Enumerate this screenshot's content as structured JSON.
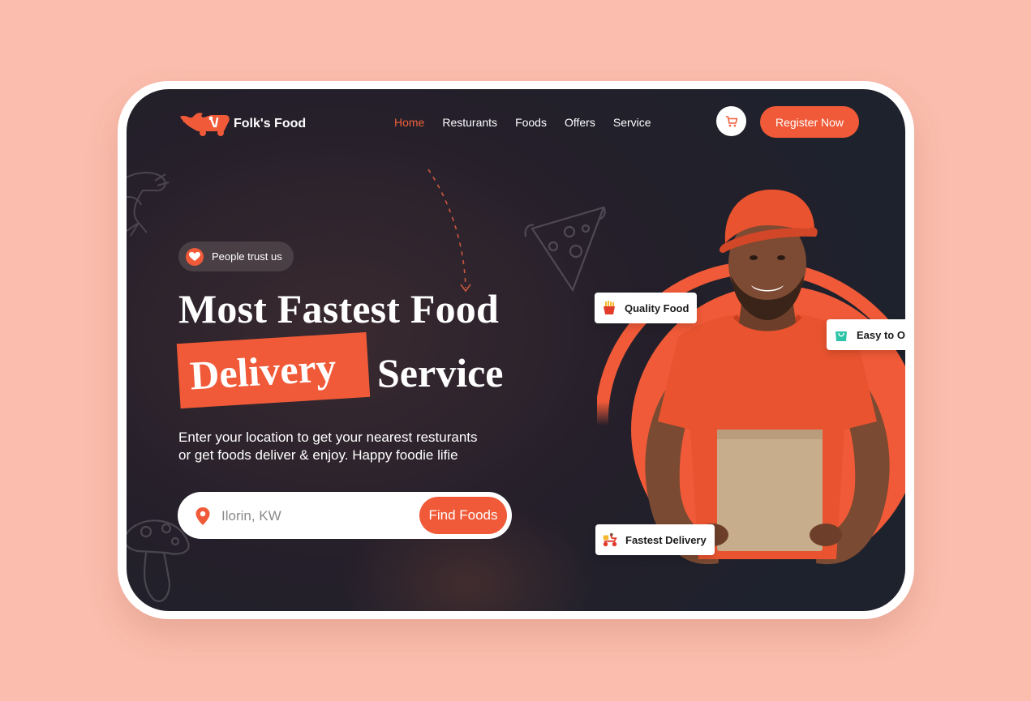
{
  "brand": {
    "name": "Folk's Food"
  },
  "nav": {
    "items": [
      {
        "label": "Home",
        "active": true
      },
      {
        "label": "Resturants",
        "active": false
      },
      {
        "label": "Foods",
        "active": false
      },
      {
        "label": "Offers",
        "active": false
      },
      {
        "label": "Service",
        "active": false
      }
    ],
    "cart_icon": "cart-icon",
    "register_label": "Register Now"
  },
  "hero": {
    "trust_label": "People trust us",
    "title_line1": "Most Fastest Food",
    "title_highlight": "Delivery",
    "title_line2_rest": "Service",
    "description_line1": "Enter your location to get your nearest resturants",
    "description_line2": "or get foods deliver & enjoy. Happy foodie lifie",
    "search": {
      "value": "",
      "placeholder": "Ilorin, KW",
      "button_label": "Find Foods"
    }
  },
  "tags": [
    {
      "label": "Quality Food",
      "icon": "fries-icon"
    },
    {
      "label": "Easy to Ord",
      "icon": "shopping-bag-icon"
    },
    {
      "label": "Fastest Delivery",
      "icon": "scooter-icon"
    }
  ],
  "colors": {
    "background": "#fbbdad",
    "accent": "#f05a38",
    "screen": "#241f2a",
    "text": "#ffffff"
  }
}
